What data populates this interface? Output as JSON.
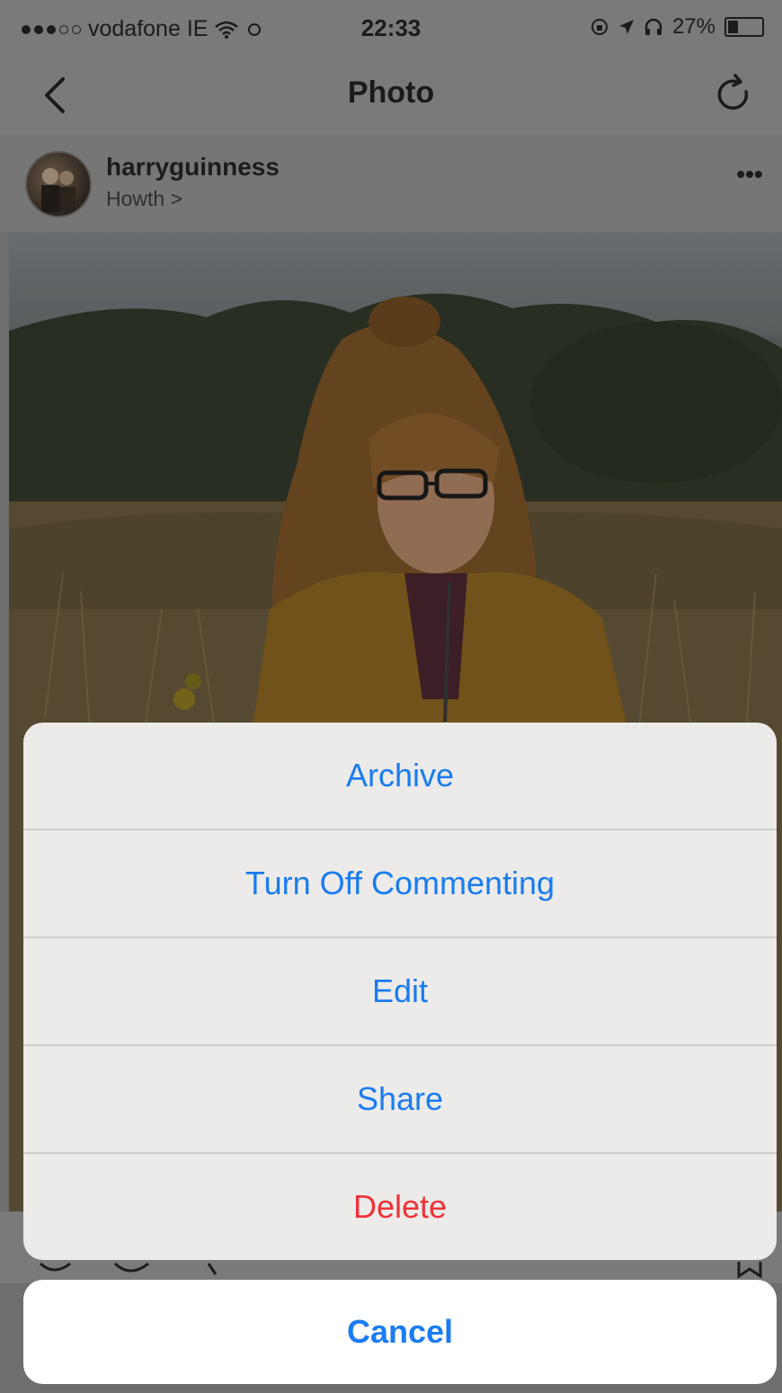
{
  "status_bar": {
    "carrier": "vodafone IE",
    "time": "22:33",
    "battery": "27%",
    "battery_level": 0.27
  },
  "nav": {
    "title": "Photo",
    "back_icon": "chevron-left-icon",
    "refresh_icon": "refresh-icon"
  },
  "post": {
    "username": "harryguinness",
    "location": "Howth >",
    "more_icon": "ellipsis-icon"
  },
  "action_sheet": {
    "items": [
      {
        "label": "Archive"
      },
      {
        "label": "Turn Off Commenting"
      },
      {
        "label": "Edit"
      },
      {
        "label": "Share"
      },
      {
        "label": "Delete"
      }
    ],
    "cancel_label": "Cancel"
  },
  "colors": {
    "action_blue": "#1a7cf0",
    "destructive_red": "#ee3338",
    "sheet_bg": "#ecebea"
  }
}
